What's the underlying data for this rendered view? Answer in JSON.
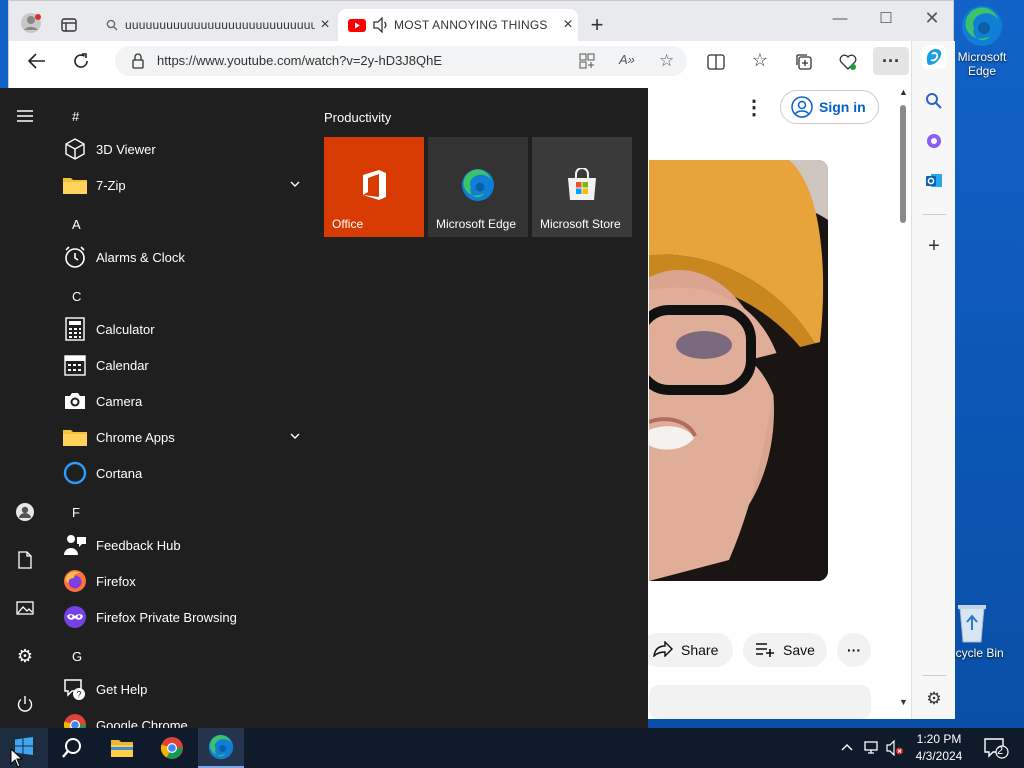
{
  "desktop": {
    "icons": [
      {
        "label": "Microsoft Edge",
        "icon": "edge-icon"
      },
      {
        "label": "Recycle Bin",
        "icon": "recycle-bin-icon"
      }
    ]
  },
  "browser": {
    "tabs": [
      {
        "title": "uuuuuuuuuuuuuuuuuuuuuuuuuuuuuuuu",
        "icon": "search-icon"
      },
      {
        "title": "MOST ANNOYING THINGS",
        "icon": "youtube-icon",
        "audio": "speaker-icon"
      }
    ],
    "url": "https://www.youtube.com/watch?v=2y-hD3J8QhE",
    "page": {
      "sign_in": "Sign in",
      "share": "Share",
      "save": "Save"
    }
  },
  "start_menu": {
    "letters": [
      "#",
      "A",
      "C",
      "F",
      "G"
    ],
    "apps": [
      {
        "label": "3D Viewer",
        "icon": "cube-icon"
      },
      {
        "label": "7-Zip",
        "icon": "folder-icon",
        "expandable": true
      },
      {
        "label": "Alarms & Clock",
        "icon": "clock-icon"
      },
      {
        "label": "Calculator",
        "icon": "calculator-icon"
      },
      {
        "label": "Calendar",
        "icon": "calendar-icon"
      },
      {
        "label": "Camera",
        "icon": "camera-icon"
      },
      {
        "label": "Chrome Apps",
        "icon": "folder-icon",
        "expandable": true
      },
      {
        "label": "Cortana",
        "icon": "cortana-icon"
      },
      {
        "label": "Feedback Hub",
        "icon": "feedback-icon"
      },
      {
        "label": "Firefox",
        "icon": "firefox-icon"
      },
      {
        "label": "Firefox Private Browsing",
        "icon": "firefox-private-icon"
      },
      {
        "label": "Get Help",
        "icon": "help-icon"
      },
      {
        "label": "Google Chrome",
        "icon": "chrome-icon"
      }
    ],
    "group": "Productivity",
    "tiles": [
      {
        "label": "Office",
        "color": "#d83b01",
        "icon": "office-icon"
      },
      {
        "label": "Microsoft Edge",
        "color": "#333333",
        "icon": "edge-icon"
      },
      {
        "label": "Microsoft Store",
        "color": "#3a3a3a",
        "icon": "store-icon"
      }
    ]
  },
  "taskbar": {
    "time": "1:20 PM",
    "date": "4/3/2024",
    "notification_count": "2"
  }
}
